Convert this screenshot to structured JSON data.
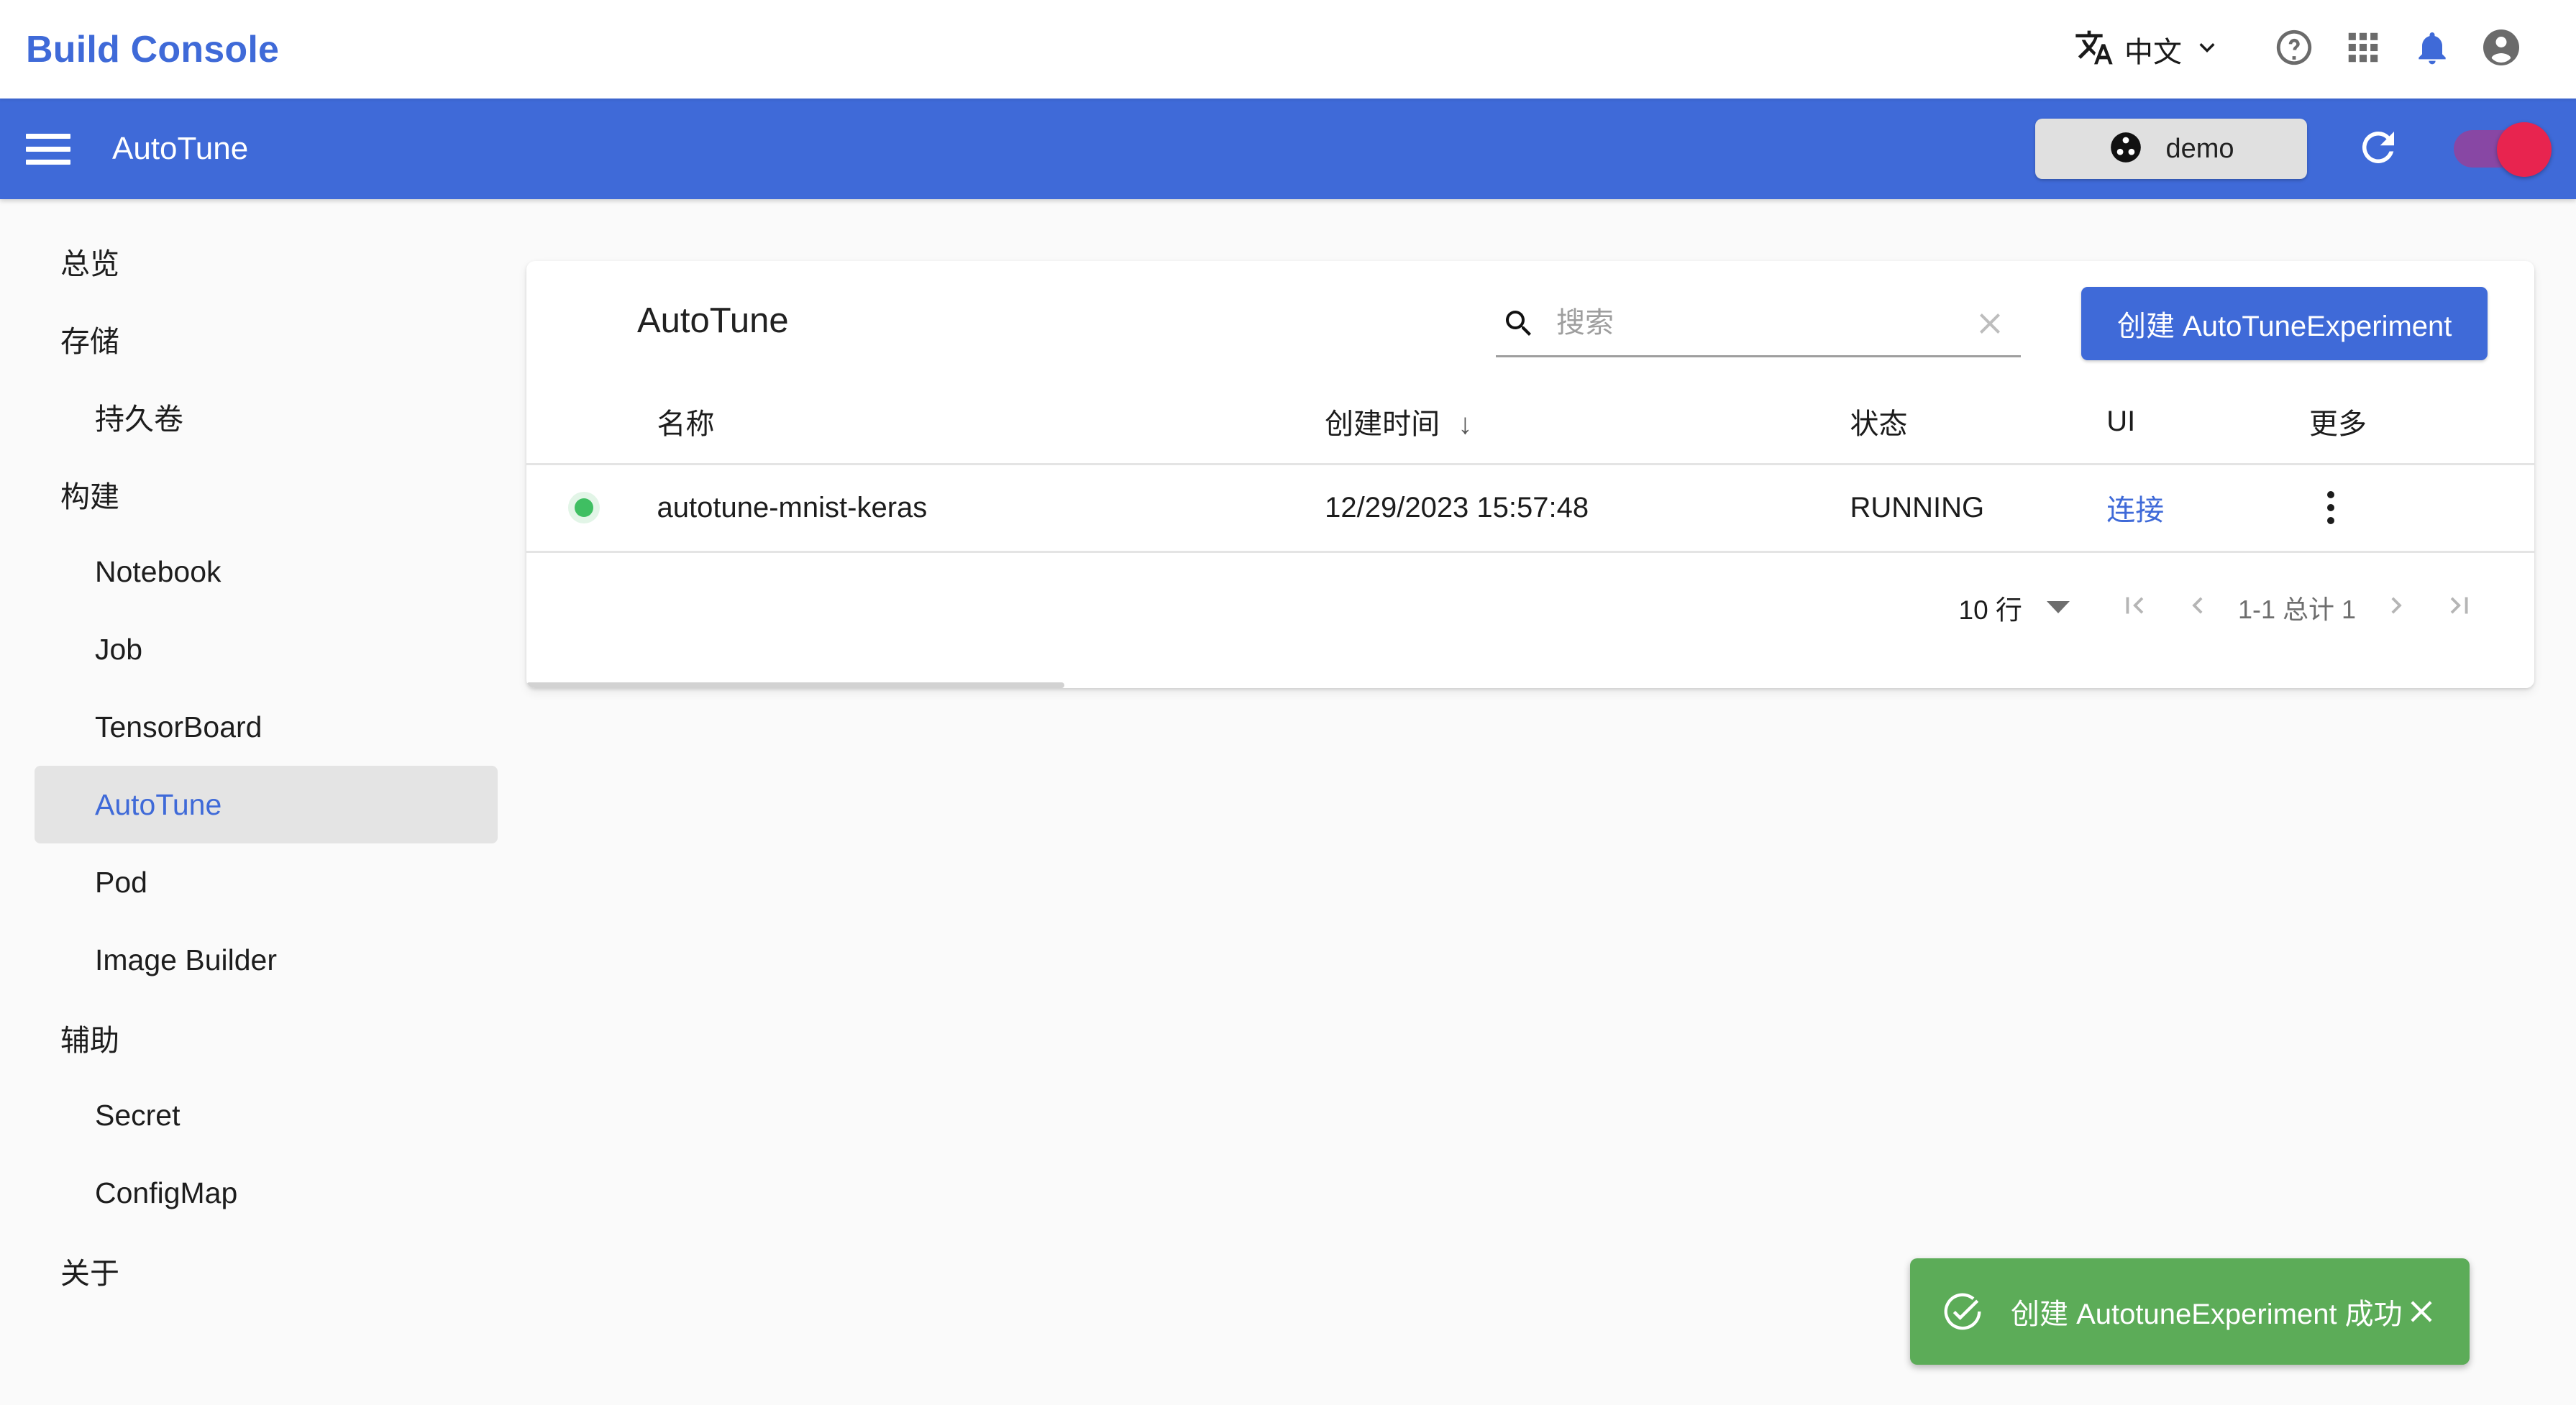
{
  "header": {
    "brand": "Build Console",
    "language_label": "中文",
    "icons": {
      "translate": "translate-icon",
      "chevron": "chevron-down-icon",
      "help": "help-circle-icon",
      "apps": "apps-grid-icon",
      "notifications": "bell-icon",
      "account": "account-circle-icon"
    }
  },
  "toolbar": {
    "title": "AutoTune",
    "namespace_chip": "demo",
    "menu_icon": "hamburger-menu-icon",
    "refresh_icon": "refresh-icon",
    "toggle_on": true
  },
  "sidebar": {
    "items": [
      {
        "label": "总览",
        "level": "group",
        "active": false
      },
      {
        "label": "存储",
        "level": "group",
        "active": false
      },
      {
        "label": "持久卷",
        "level": "child",
        "active": false
      },
      {
        "label": "构建",
        "level": "group",
        "active": false
      },
      {
        "label": "Notebook",
        "level": "child",
        "active": false
      },
      {
        "label": "Job",
        "level": "child",
        "active": false
      },
      {
        "label": "TensorBoard",
        "level": "child",
        "active": false
      },
      {
        "label": "AutoTune",
        "level": "child",
        "active": true
      },
      {
        "label": "Pod",
        "level": "child",
        "active": false
      },
      {
        "label": "Image Builder",
        "level": "child",
        "active": false
      },
      {
        "label": "辅助",
        "level": "group",
        "active": false
      },
      {
        "label": "Secret",
        "level": "child",
        "active": false
      },
      {
        "label": "ConfigMap",
        "level": "child",
        "active": false
      },
      {
        "label": "关于",
        "level": "group",
        "active": false
      }
    ]
  },
  "card": {
    "title": "AutoTune",
    "search": {
      "value": "",
      "placeholder": "搜索",
      "icon": "search-icon",
      "clear_icon": "close-icon"
    },
    "create_button": "创建 AutoTuneExperiment",
    "table": {
      "headers": {
        "status_dot": "",
        "name": "名称",
        "created": "创建时间",
        "sort_arrow": "↓",
        "state": "状态",
        "ui": "UI",
        "more": "更多"
      },
      "rows": [
        {
          "status": "healthy",
          "name": "autotune-mnist-keras",
          "created": "12/29/2023 15:57:48",
          "state": "RUNNING",
          "ui_link": "连接",
          "more_icon": "more-vert-icon"
        }
      ]
    },
    "pagination": {
      "rows_per_page": "10 行",
      "range": "1-1 总计 1",
      "first_icon": "first-page-icon",
      "prev_icon": "chevron-left-icon",
      "next_icon": "chevron-right-icon",
      "last_icon": "last-page-icon"
    }
  },
  "toast": {
    "message": "创建 AutotuneExperiment 成功",
    "icon": "check-circle-icon",
    "close_icon": "close-icon"
  },
  "colors": {
    "brand_blue": "#3f6ad8",
    "toolbar_blue": "#3f6ad8",
    "success_green": "#5cac58",
    "status_green": "#3fbf62",
    "toggle_track": "#8e44a0",
    "toggle_thumb": "#e8244f",
    "page_bg": "#fafafa"
  }
}
